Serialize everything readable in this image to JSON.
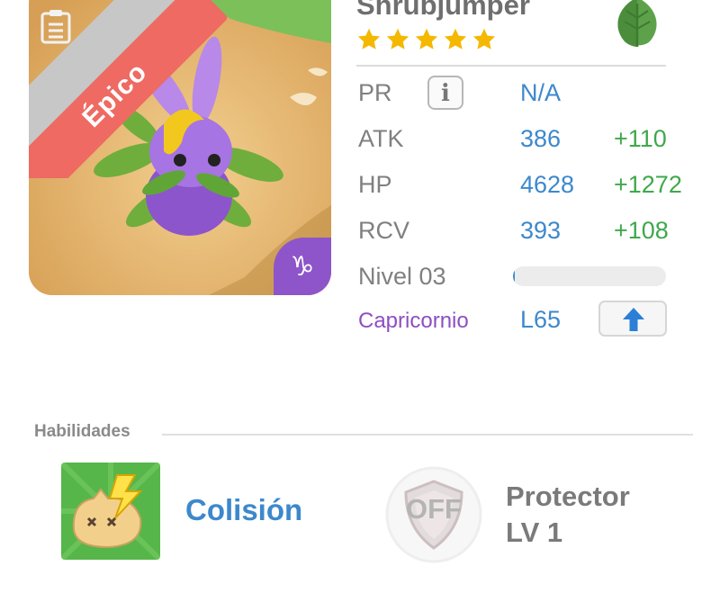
{
  "monster": {
    "name": "Shrubjumper",
    "rarity": "Épico",
    "stars": 5,
    "element_icon": "leaf-icon",
    "zodiac_icon": "capricorn-icon"
  },
  "stats": {
    "pr": {
      "label": "PR",
      "value": "N/A"
    },
    "atk": {
      "label": "ATK",
      "value": "386",
      "bonus": "+110"
    },
    "hp": {
      "label": "HP",
      "value": "4628",
      "bonus": "+1272"
    },
    "rcv": {
      "label": "RCV",
      "value": "393",
      "bonus": "+108"
    },
    "level": {
      "label": "Nivel 03",
      "xp_fraction": 0.01
    },
    "zodiac": {
      "label": "Capricornio",
      "value": "L65"
    }
  },
  "abilities": {
    "section_title": "Habilidades",
    "active": {
      "name": "Colisión",
      "icon": "collision-icon"
    },
    "passive": {
      "name": "Protector",
      "level": "LV 1",
      "status": "OFF",
      "icon": "shield-icon"
    }
  },
  "colors": {
    "accent_blue": "#3d88cc",
    "bonus_green": "#3fa84c",
    "zodiac_purple": "#8d4ec3",
    "rarity_red": "#ee6a63"
  }
}
